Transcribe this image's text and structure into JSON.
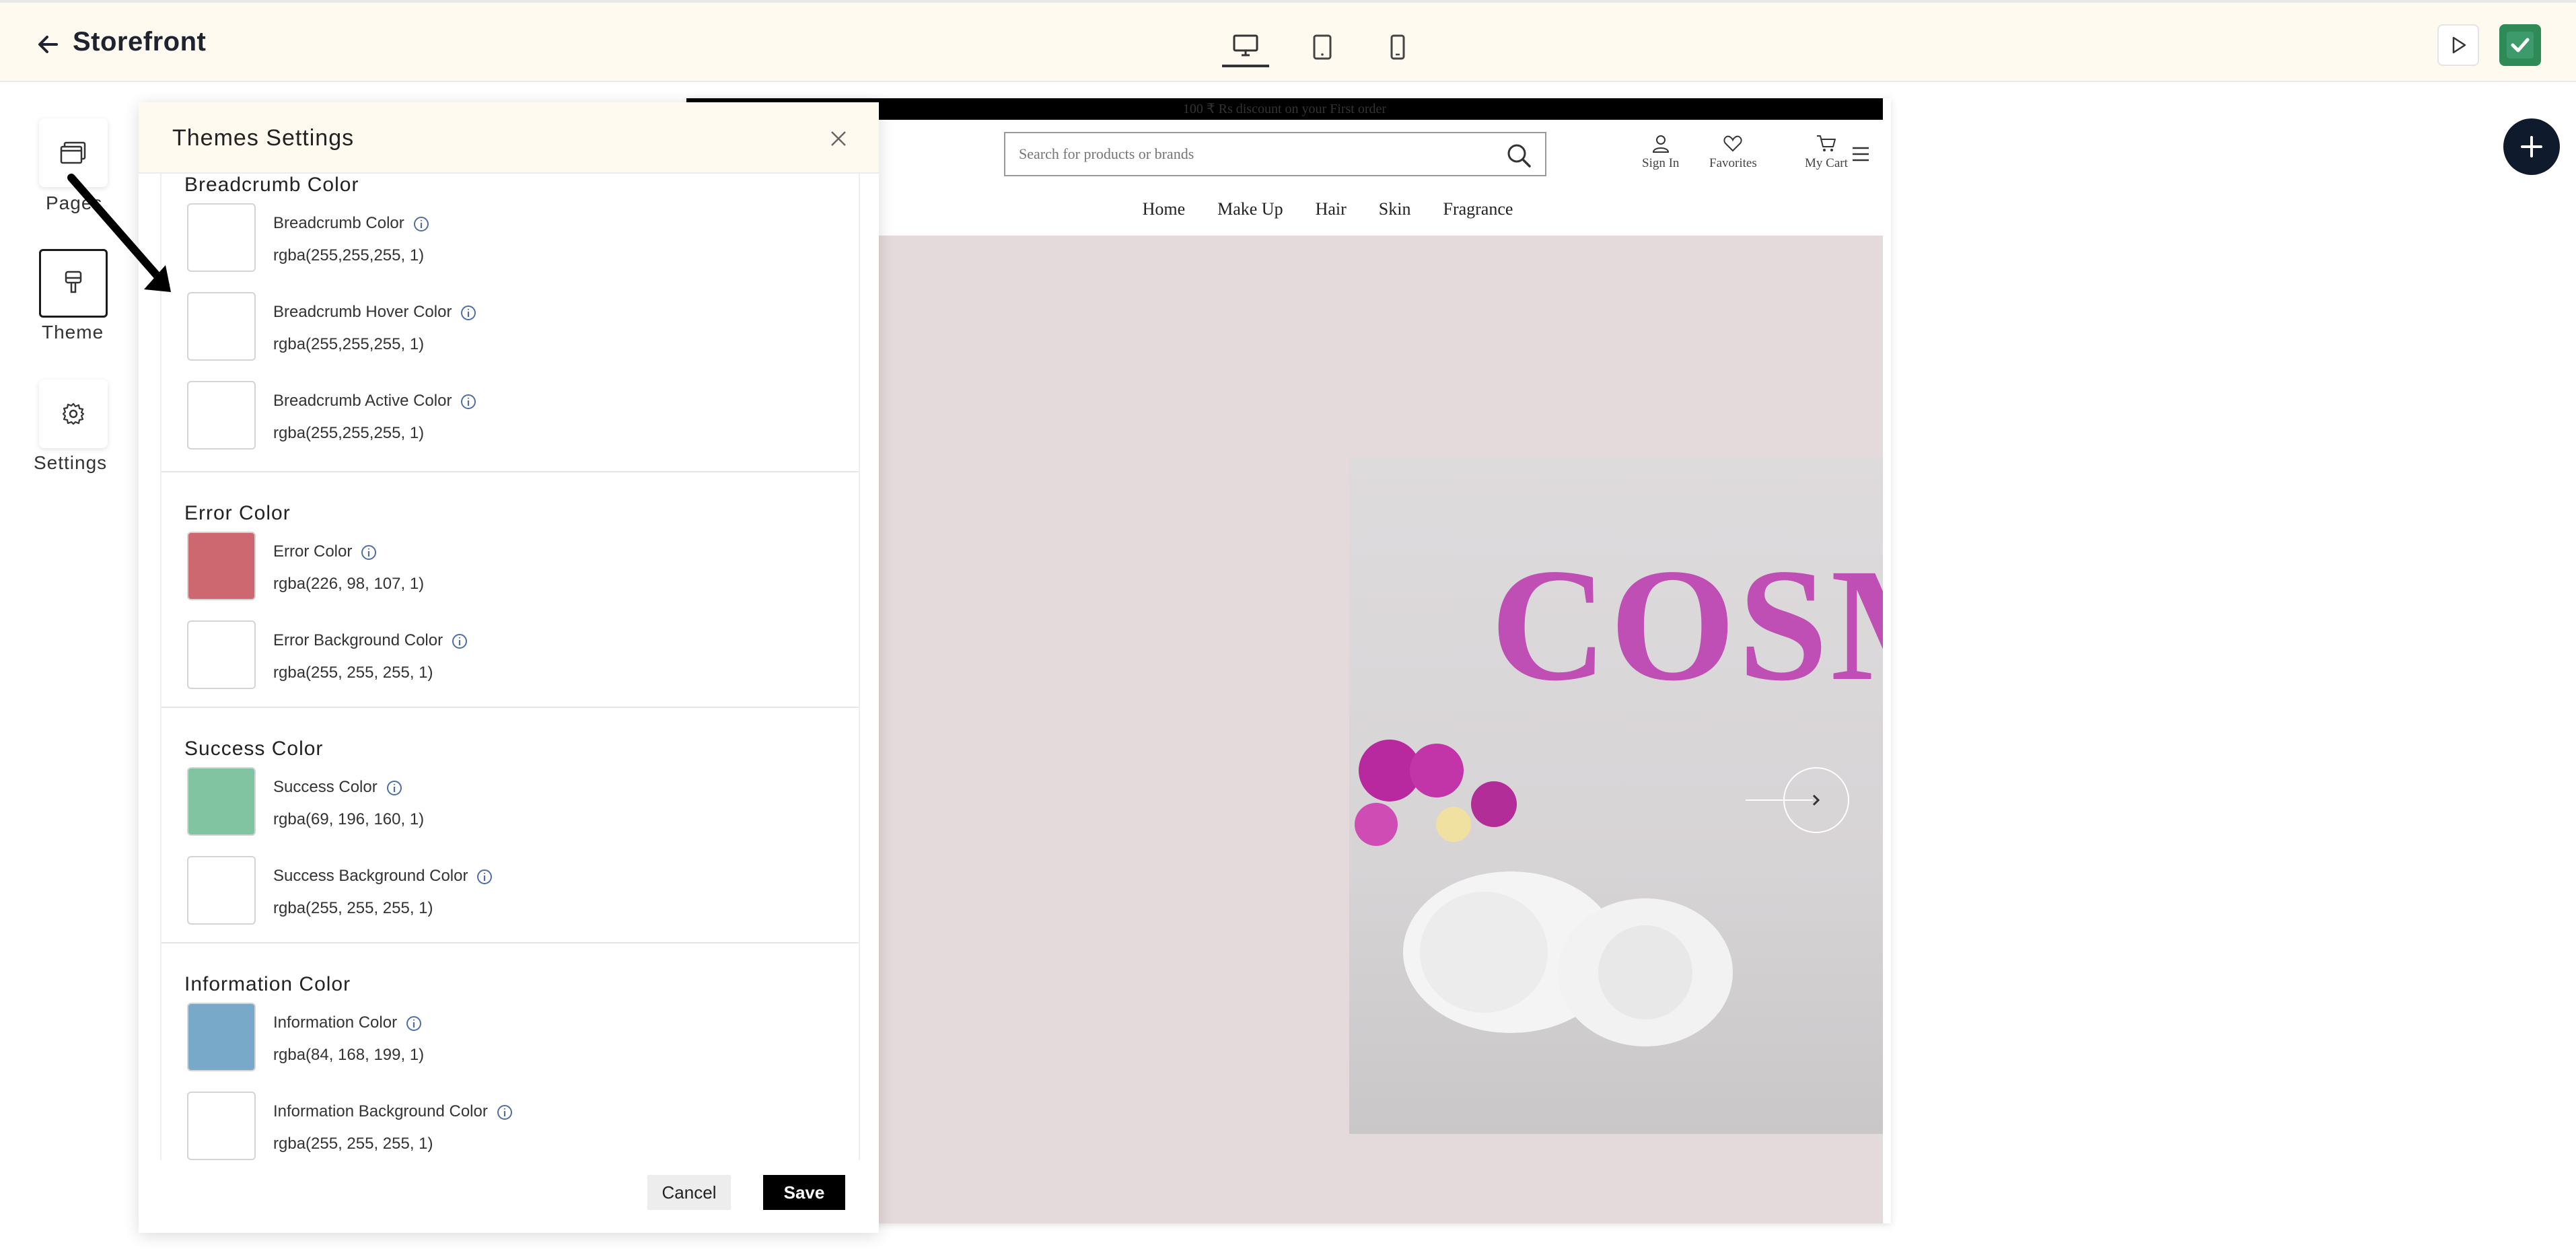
{
  "app": {
    "title": "Storefront"
  },
  "sidenav": [
    {
      "label": "Pages",
      "icon": "pages-icon"
    },
    {
      "label": "Theme",
      "icon": "theme-brush-icon"
    },
    {
      "label": "Settings",
      "icon": "gear-icon"
    }
  ],
  "devices": [
    "desktop-icon",
    "tablet-icon",
    "mobile-icon"
  ],
  "panel": {
    "title": "Themes Settings",
    "sections": [
      {
        "title": "Breadcrumb Color",
        "rows": [
          {
            "label": "Breadcrumb Color",
            "value": "rgba(255,255,255, 1)",
            "swatch": "#ffffff"
          },
          {
            "label": "Breadcrumb Hover Color",
            "value": "rgba(255,255,255, 1)",
            "swatch": "#ffffff"
          },
          {
            "label": "Breadcrumb Active Color",
            "value": "rgba(255,255,255, 1)",
            "swatch": "#ffffff"
          }
        ]
      },
      {
        "title": "Error Color",
        "rows": [
          {
            "label": "Error Color",
            "value": "rgba(226, 98, 107, 1)",
            "swatch": "#cd6770"
          },
          {
            "label": "Error Background Color",
            "value": "rgba(255, 255, 255, 1)",
            "swatch": "#ffffff"
          }
        ]
      },
      {
        "title": "Success Color",
        "rows": [
          {
            "label": "Success Color",
            "value": "rgba(69, 196, 160, 1)",
            "swatch": "#80c4a2"
          },
          {
            "label": "Success Background Color",
            "value": "rgba(255, 255, 255, 1)",
            "swatch": "#ffffff"
          }
        ]
      },
      {
        "title": "Information Color",
        "rows": [
          {
            "label": "Information Color",
            "value": "rgba(84, 168, 199, 1)",
            "swatch": "#79a9c9"
          },
          {
            "label": "Information Background Color",
            "value": "rgba(255, 255, 255, 1)",
            "swatch": "#ffffff"
          }
        ]
      }
    ],
    "cancel_label": "Cancel",
    "save_label": "Save"
  },
  "storefront": {
    "promo_text": "100 ₹ Rs discount on your First order",
    "search_placeholder": "Search for products or brands",
    "actions": [
      "Sign In",
      "Favorites",
      "My Cart"
    ],
    "nav": [
      "Home",
      "Make Up",
      "Hair",
      "Skin",
      "Fragrance"
    ],
    "hero_word": "COSM"
  }
}
